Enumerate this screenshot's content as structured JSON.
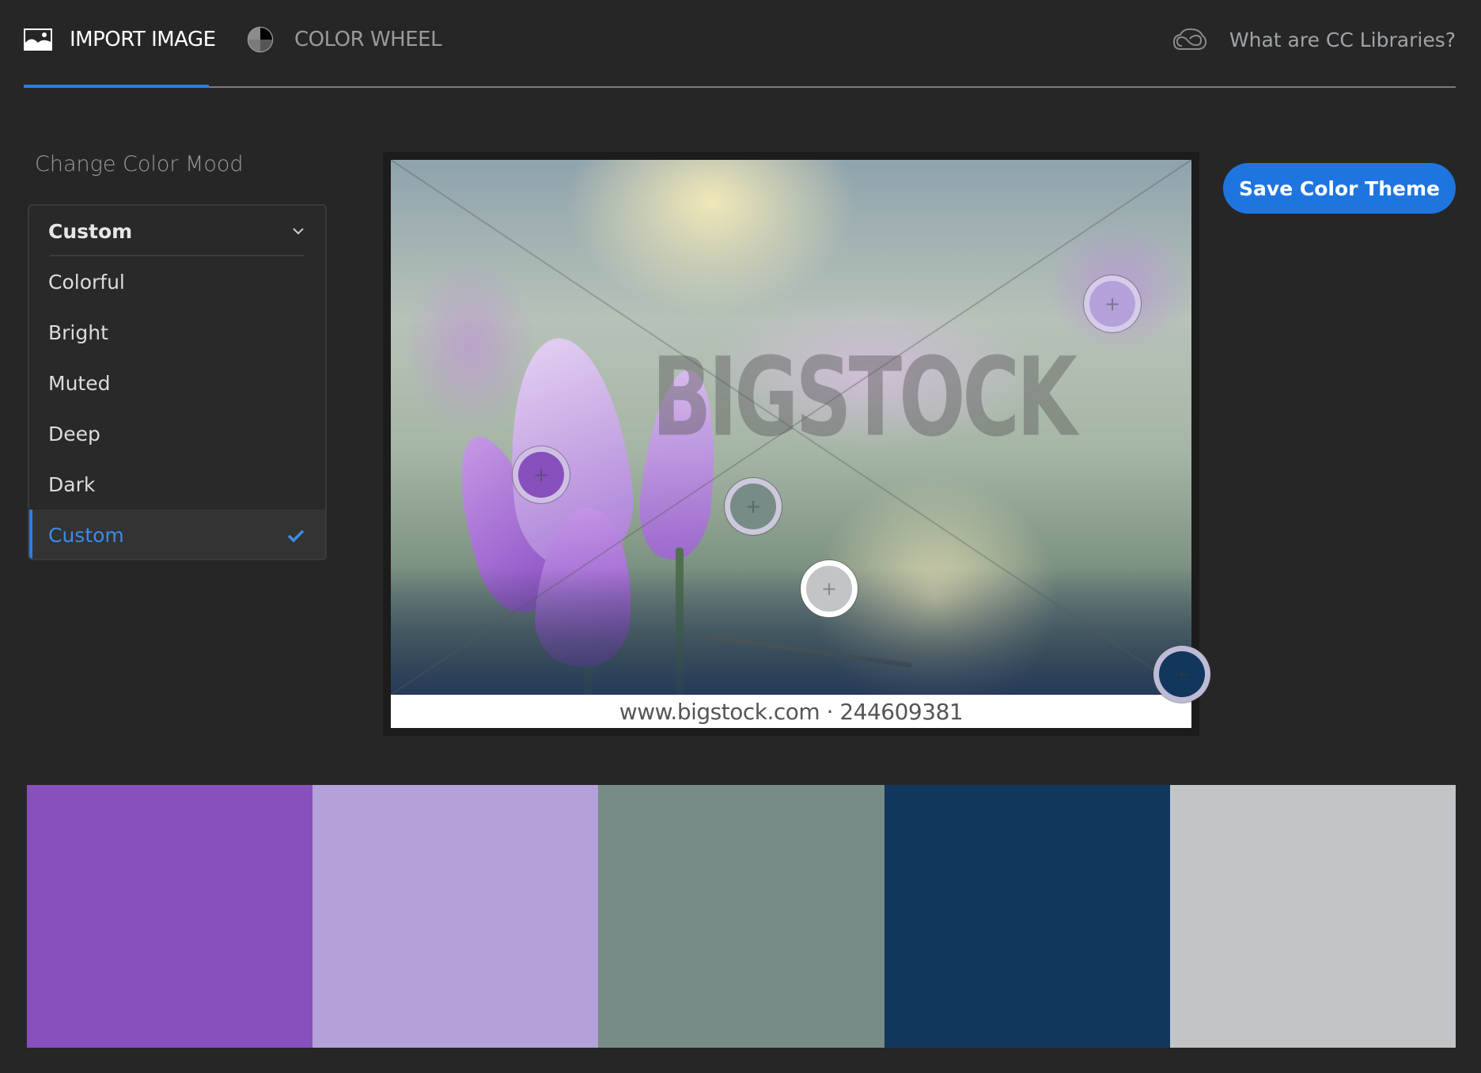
{
  "header": {
    "tabs": [
      {
        "label": "IMPORT IMAGE",
        "icon": "image-icon",
        "active": true
      },
      {
        "label": "COLOR WHEEL",
        "icon": "color-wheel-icon",
        "active": false
      }
    ],
    "cc_link": {
      "label": "What are CC Libraries?",
      "icon": "creative-cloud-icon"
    }
  },
  "mood": {
    "title": "Change Color Mood",
    "selected": "Custom",
    "options": [
      {
        "label": "Colorful",
        "selected": false
      },
      {
        "label": "Bright",
        "selected": false
      },
      {
        "label": "Muted",
        "selected": false
      },
      {
        "label": "Deep",
        "selected": false
      },
      {
        "label": "Dark",
        "selected": false
      },
      {
        "label": "Custom",
        "selected": true
      }
    ]
  },
  "image": {
    "watermark": "BIGSTOCK",
    "footer": "www.bigstock.com · 244609381",
    "pickers": [
      {
        "color": "#8750bd",
        "active": false
      },
      {
        "color": "#b4a1d9",
        "active": false
      },
      {
        "color": "#778c86",
        "active": false
      },
      {
        "color": "#12375c",
        "active": false
      },
      {
        "color": "#c1c5c8",
        "active": true
      }
    ]
  },
  "actions": {
    "save_label": "Save Color Theme"
  },
  "theme": {
    "swatches": [
      "#8750bd",
      "#b4a1d9",
      "#778c86",
      "#12375c",
      "#c1c5c8"
    ],
    "accent": "#2d7ce4"
  }
}
